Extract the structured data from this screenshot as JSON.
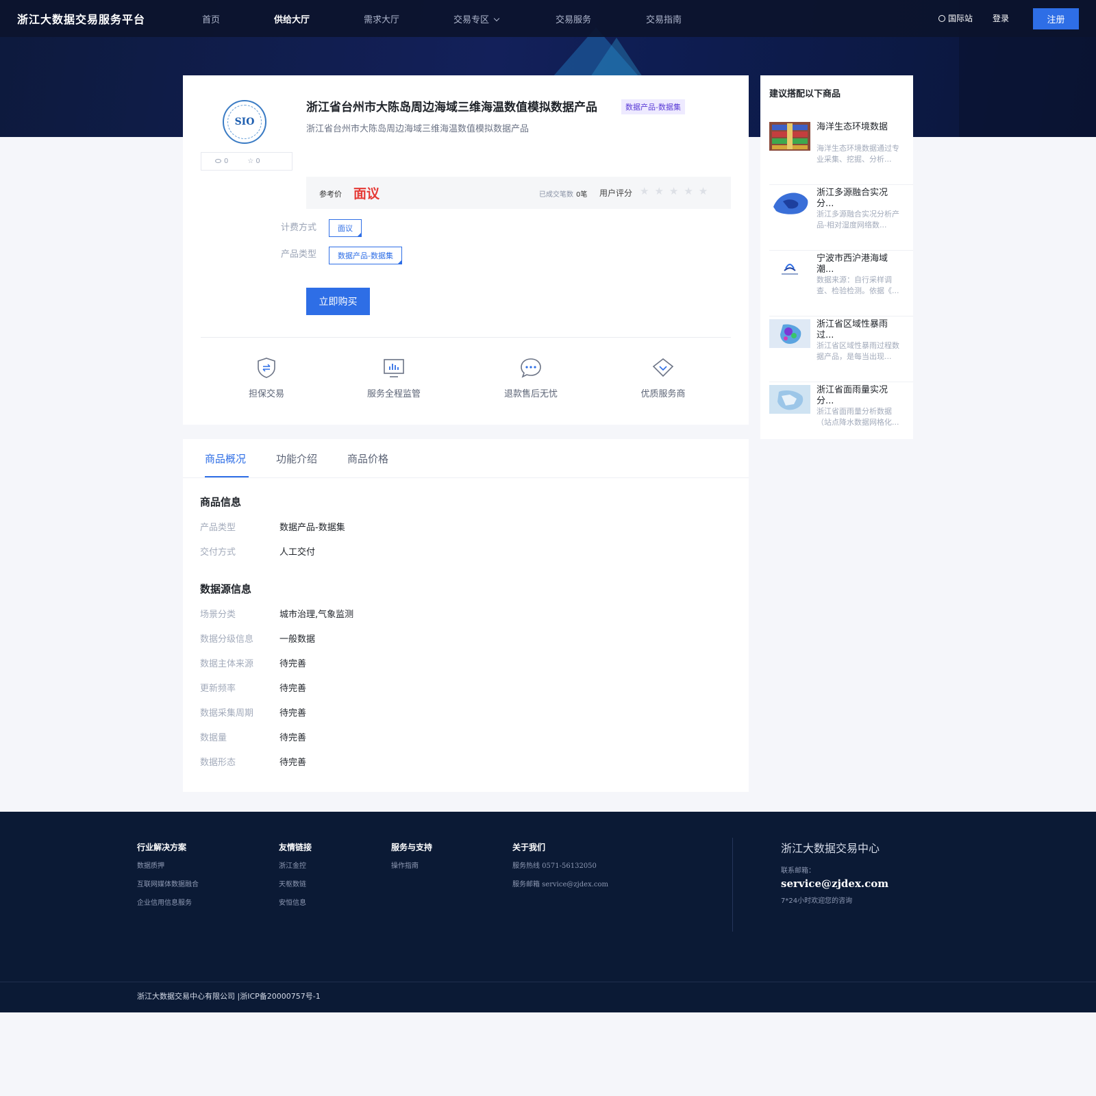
{
  "header": {
    "brand": "浙江大数据交易服务平台",
    "nav": [
      "首页",
      "供给大厅",
      "需求大厅",
      "交易专区",
      "交易服务",
      "交易指南"
    ],
    "active_nav": "供给大厅",
    "intl": "国际站",
    "login": "登录",
    "register": "注册"
  },
  "product": {
    "logo_text": "SIO",
    "views": "0",
    "favorites": "0",
    "title": "浙江省台州市大陈岛周边海域三维海温数值模拟数据产品",
    "tag": "数据产品-数据集",
    "subtitle": "浙江省台州市大陈岛周边海域三维海温数值模拟数据产品",
    "price_label": "参考价",
    "price_value": "面议",
    "deal_label": "已成交笔数",
    "deal_value": "0笔",
    "rating_label": "用户评分",
    "rating_stars": "★★★★★",
    "billing_label": "计费方式",
    "billing_value": "面议",
    "type_label": "产品类型",
    "type_value": "数据产品-数据集",
    "buy_button": "立即购买",
    "features": [
      "担保交易",
      "服务全程监管",
      "退款售后无忧",
      "优质服务商"
    ]
  },
  "recommendations": {
    "title": "建议搭配以下商品",
    "items": [
      {
        "name": "海洋生态环境数据",
        "desc": "海洋生态环境数据通过专业采集、挖掘、分析..."
      },
      {
        "name": "浙江多源融合实况分...",
        "desc": "浙江多源融合实况分析产品-相对湿度网络数..."
      },
      {
        "name": "宁波市西沪港海域潮...",
        "desc": "数据来源：自行采样调查、检验检测。依据《..."
      },
      {
        "name": "浙江省区域性暴雨过...",
        "desc": "浙江省区域性暴雨过程数据产品，是每当出现..."
      },
      {
        "name": "浙江省面雨量实况分...",
        "desc": "浙江省面雨量分析数据（站点降水数据网格化..."
      }
    ]
  },
  "detail": {
    "tabs": [
      "商品概况",
      "功能介绍",
      "商品价格"
    ],
    "product_info_title": "商品信息",
    "product_info": [
      {
        "label": "产品类型",
        "value": "数据产品-数据集"
      },
      {
        "label": "交付方式",
        "value": "人工交付"
      }
    ],
    "source_info_title": "数据源信息",
    "source_info": [
      {
        "label": "场景分类",
        "value": "城市治理,气象监测"
      },
      {
        "label": "数据分级信息",
        "value": "一般数据"
      },
      {
        "label": "数据主体来源",
        "value": "待完善"
      },
      {
        "label": "更新频率",
        "value": "待完善"
      },
      {
        "label": "数据采集周期",
        "value": "待完善"
      },
      {
        "label": "数据量",
        "value": "待完善"
      },
      {
        "label": "数据形态",
        "value": "待完善"
      }
    ]
  },
  "footer": {
    "cols": [
      {
        "title": "行业解决方案",
        "links": [
          "数据质押",
          "互联网媒体数据融合",
          "企业信用信息服务"
        ]
      },
      {
        "title": "友情链接",
        "links": [
          "浙江金控",
          "天枢数链",
          "安恒信息"
        ]
      },
      {
        "title": "服务与支持",
        "links": [
          "操作指南"
        ]
      },
      {
        "title": "关于我们",
        "links": [
          "服务热线 0571-56132050",
          "服务邮箱 service@zjdex.com"
        ]
      }
    ],
    "brand": "浙江大数据交易中心",
    "contact_label": "联系邮箱：",
    "email": "service@zjdex.com",
    "hours": "7*24小时欢迎您的咨询",
    "copyright": "浙江大数据交易中心有限公司 |浙ICP备20000757号-1"
  }
}
